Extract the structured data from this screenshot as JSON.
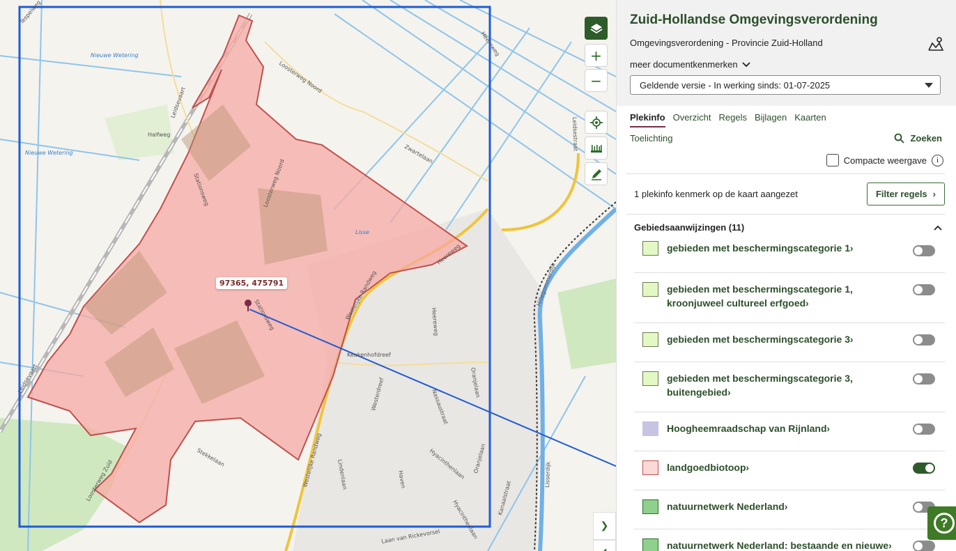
{
  "map": {
    "coordinate_label": "97365, 475791",
    "street_labels": [
      "Tespelweg",
      "Nieuwe Wetering",
      "Nieuwe Wetering",
      "Leidsevaart",
      "Halfweg",
      "Loosterweg Noord",
      "Loosterweg Noord",
      "Stationsweg",
      "Zwartelaan",
      "Lisse",
      "Heereweg",
      "Heereweg",
      "Stationsweg",
      "Westelijke Randweg",
      "Keukenhofdreef",
      "Heereweg",
      "Leidsevaart",
      "Loosterweg Zuid",
      "Nassaustraat",
      "Westerdreef",
      "Stekkelaan",
      "Westelijke Randweg",
      "Lindenlaan",
      "Haven",
      "Oranjelaan",
      "Oranjelaan",
      "Hyacinthenlaan",
      "Kanaalstraat",
      "Leidsestraat",
      "Hyacinthenlaan",
      "Hillegommerdijk",
      "Lisserdijk",
      "Laan van Rickevorsel"
    ],
    "polygon_color": "#f7a9a4",
    "selection_color": "#1f5bd6",
    "arrow_color": "#1f5bd6",
    "controls": {
      "layers_icon": "layers-icon",
      "zoom_in": "+",
      "zoom_out": "−",
      "locate_icon": "crosshair-icon",
      "measure_icon": "ruler-icon",
      "draw_icon": "pencil-icon"
    }
  },
  "panel": {
    "title": "Zuid-Hollandse Omgevingsverordening",
    "subtitle": "Omgevingsverordening - Provincie Zuid-Holland",
    "meer": "meer documentkenmerken",
    "version": "Geldende versie - In werking sinds: 01-07-2025",
    "tabs": [
      {
        "label": "Plekinfo",
        "active": true
      },
      {
        "label": "Overzicht"
      },
      {
        "label": "Regels"
      },
      {
        "label": "Bijlagen"
      },
      {
        "label": "Kaarten"
      }
    ],
    "toelichting": "Toelichting",
    "zoeken": "Zoeken",
    "compact": "Compacte weergave",
    "filter_text": "1 plekinfo kenmerk op de kaart aangezet",
    "filter_button": "Filter regels",
    "section_title": "Gebiedsaanwijzingen (11)",
    "items": [
      {
        "label": "gebieden met beschermingscategorie 1",
        "swatch": "#e4f8c4",
        "border": "#6b7a55",
        "on": false
      },
      {
        "label": "gebieden met beschermingscategorie 1, kroonjuweel cultureel erfgoed",
        "swatch": "#e4f8c4",
        "border": "#6b7a55",
        "on": false
      },
      {
        "label": "gebieden met beschermingscategorie 3",
        "swatch": "#e4f8c4",
        "border": "#6b7a55",
        "on": false
      },
      {
        "label": "gebieden met beschermingscategorie 3, buitengebied",
        "swatch": "#e4f8c4",
        "border": "#6b7a55",
        "on": false
      },
      {
        "label": "Hoogheemraadschap van Rijnland",
        "swatch": "#c7c3e2",
        "border": "#c7c3e2",
        "on": false
      },
      {
        "label": "landgoedbiotoop",
        "swatch": "#fbd9d6",
        "border": "#c0504d",
        "on": true
      },
      {
        "label": "natuurnetwerk Nederland",
        "swatch": "#8fd08d",
        "border": "#2e6b2a",
        "on": false
      },
      {
        "label": "natuurnetwerk Nederland: bestaande en nieuwe",
        "swatch": "#8fd08d",
        "border": "#2e6b2a",
        "on": false
      }
    ]
  }
}
